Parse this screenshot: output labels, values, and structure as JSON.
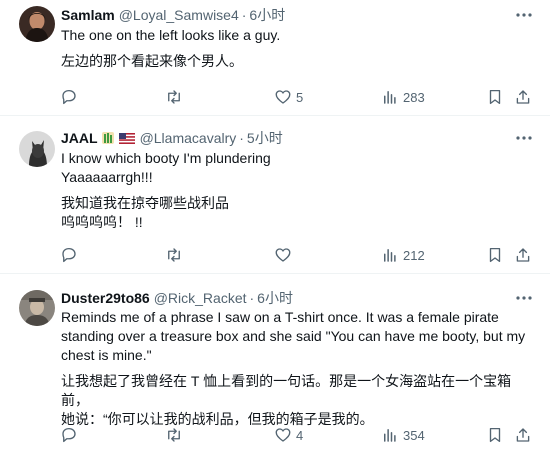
{
  "tweets": [
    {
      "name": "Samlam",
      "handle": "@Loyal_Samwise4",
      "dot": "·",
      "time": "6小时",
      "lines": [
        "The one on the left looks like a guy.",
        "左边的那个看起来像个男人。"
      ],
      "stats": {
        "replies": "",
        "retweets": "",
        "likes": "5",
        "views": "283"
      }
    },
    {
      "name": "JAAL",
      "handle": "@Llamacavalry",
      "dot": "·",
      "time": "5小时",
      "lines": [
        "I know which booty I'm plundering",
        "Yaaaaaarrgh!!!",
        "我知道我在掠夺哪些战利品",
        "呜呜呜呜！ !!"
      ],
      "stats": {
        "replies": "",
        "retweets": "",
        "likes": "",
        "views": "212"
      }
    },
    {
      "name": "Duster29to86",
      "handle": "@Rick_Racket",
      "dot": "·",
      "time": "6小时",
      "lines": [
        "Reminds me of a phrase I saw on a T-shirt once. It was a female pirate",
        "standing over a treasure box and she said \"You can have me booty, but my",
        "chest is mine.\"",
        "让我想起了我曾经在 T 恤上看到的一句话。那是一个女海盗站在一个宝箱前，",
        "她说：“你可以让我的战利品，但我的箱子是我的。"
      ],
      "stats": {
        "replies": "",
        "retweets": "",
        "likes": "4",
        "views": "354"
      }
    }
  ],
  "icons": {
    "reply": "reply-icon",
    "retweet": "retweet-icon",
    "like": "heart-icon",
    "views": "views-icon",
    "bookmark": "bookmark-icon",
    "share": "share-icon",
    "more": "more-icon",
    "flag": "us-flag-icon",
    "badge": "bamboo-emoji-icon"
  },
  "colors": {
    "text": "#0f1419",
    "secondary": "#536471",
    "divider": "#eff3f4"
  }
}
